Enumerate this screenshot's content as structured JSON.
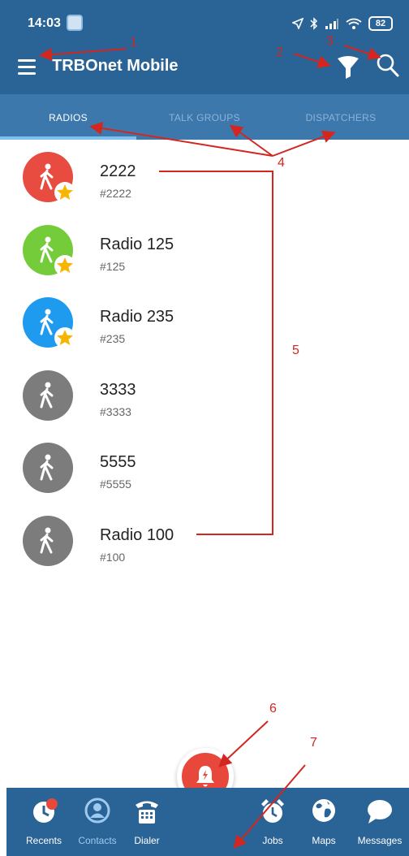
{
  "status_bar": {
    "time": "14:03",
    "battery": "82"
  },
  "app_bar": {
    "title": "TRBOnet Mobile"
  },
  "tabs": [
    {
      "label": "RADIOS",
      "active": true
    },
    {
      "label": "TALK GROUPS",
      "active": false
    },
    {
      "label": "DISPATCHERS",
      "active": false
    }
  ],
  "radios": [
    {
      "name": "2222",
      "id": "#2222",
      "color": "#e84b3f",
      "favorite": true
    },
    {
      "name": "Radio 125",
      "id": "#125",
      "color": "#75cc3a",
      "favorite": true
    },
    {
      "name": "Radio 235",
      "id": "#235",
      "color": "#1e9bef",
      "favorite": true
    },
    {
      "name": "3333",
      "id": "#3333",
      "color": "#7c7c7c",
      "favorite": false
    },
    {
      "name": "5555",
      "id": "#5555",
      "color": "#7c7c7c",
      "favorite": false
    },
    {
      "name": "Radio 100",
      "id": "#100",
      "color": "#7c7c7c",
      "favorite": false
    }
  ],
  "bottom_nav": [
    {
      "label": "Recents",
      "icon": "recents-icon"
    },
    {
      "label": "Contacts",
      "icon": "contacts-icon",
      "active": true
    },
    {
      "label": "Dialer",
      "icon": "dialer-icon"
    },
    {
      "label": "Jobs",
      "icon": "alarm-clock-icon"
    },
    {
      "label": "Maps",
      "icon": "globe-icon"
    },
    {
      "label": "Messages",
      "icon": "chat-bubble-icon"
    }
  ],
  "annotations": [
    "1",
    "2",
    "3",
    "4",
    "5",
    "6",
    "7"
  ],
  "colors": {
    "header": "#2a6396",
    "tabs": "#3d78ad",
    "tab_indicator": "#7fc0ef",
    "annotation": "#d3261f",
    "fab": "#e8473b",
    "star": "#f7b500"
  }
}
